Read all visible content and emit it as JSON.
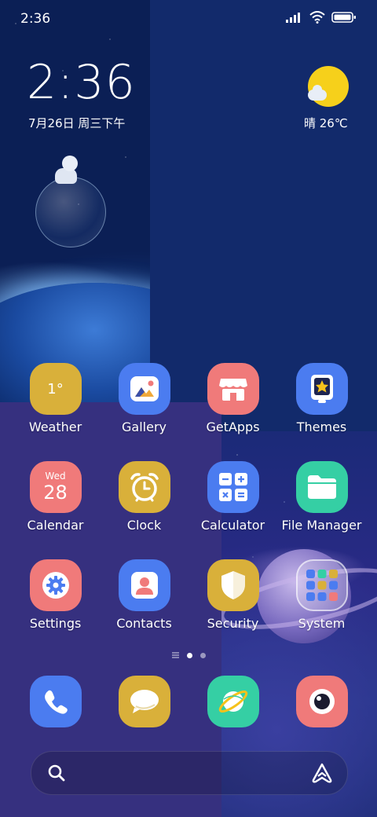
{
  "status_bar": {
    "time": "2:36",
    "icons": [
      "signal-icon",
      "wifi-icon",
      "battery-icon"
    ]
  },
  "clock_widget": {
    "time": "2:36",
    "date": "7月26日 周三下午"
  },
  "weather_widget": {
    "text": "晴 26℃",
    "icon": "sunny-cloud-icon"
  },
  "apps": [
    {
      "label": "Weather",
      "icon": "weather-icon",
      "color": "#d9b03a",
      "badge": "1°"
    },
    {
      "label": "Gallery",
      "icon": "gallery-icon",
      "color": "#4b7cf0"
    },
    {
      "label": "GetApps",
      "icon": "store-icon",
      "color": "#f07a7a"
    },
    {
      "label": "Themes",
      "icon": "themes-icon",
      "color": "#4b7cf0"
    },
    {
      "label": "Calendar",
      "icon": "calendar-icon",
      "color": "#f07a7a",
      "day": "Wed",
      "date": "28"
    },
    {
      "label": "Clock",
      "icon": "alarm-clock-icon",
      "color": "#d9b03a"
    },
    {
      "label": "Calculator",
      "icon": "calculator-icon",
      "color": "#4b7cf0"
    },
    {
      "label": "File Manager",
      "icon": "folder-icon",
      "color": "#35cfa4"
    },
    {
      "label": "Settings",
      "icon": "gear-icon",
      "color": "#f07a7a"
    },
    {
      "label": "Contacts",
      "icon": "contact-icon",
      "color": "#4b7cf0"
    },
    {
      "label": "Security",
      "icon": "shield-icon",
      "color": "#d9b03a"
    },
    {
      "label": "System",
      "icon": "folder-grid-icon",
      "color": "rgba(255,255,255,0.25)"
    }
  ],
  "page_indicator": {
    "pages": 2,
    "current": 0
  },
  "dock": [
    {
      "icon": "phone-icon",
      "color": "#4b7cf0"
    },
    {
      "icon": "messages-icon",
      "color": "#d9b03a"
    },
    {
      "icon": "browser-planet-icon",
      "color": "#35cfa4"
    },
    {
      "icon": "camera-icon",
      "color": "#f07a7a"
    }
  ],
  "search_bar": {
    "left_icon": "search-icon",
    "right_icon": "assistant-icon"
  }
}
